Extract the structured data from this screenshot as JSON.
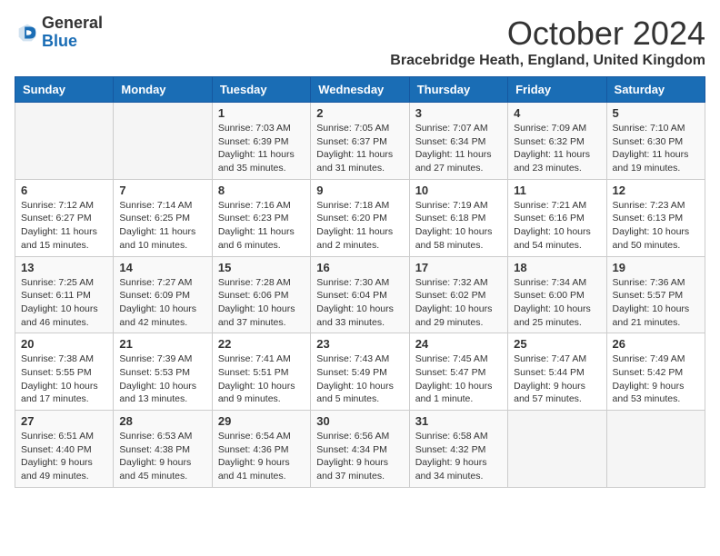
{
  "logo": {
    "general": "General",
    "blue": "Blue"
  },
  "header": {
    "month": "October 2024",
    "location": "Bracebridge Heath, England, United Kingdom"
  },
  "days_of_week": [
    "Sunday",
    "Monday",
    "Tuesday",
    "Wednesday",
    "Thursday",
    "Friday",
    "Saturday"
  ],
  "weeks": [
    [
      {
        "day": "",
        "info": ""
      },
      {
        "day": "",
        "info": ""
      },
      {
        "day": "1",
        "info": "Sunrise: 7:03 AM\nSunset: 6:39 PM\nDaylight: 11 hours and 35 minutes."
      },
      {
        "day": "2",
        "info": "Sunrise: 7:05 AM\nSunset: 6:37 PM\nDaylight: 11 hours and 31 minutes."
      },
      {
        "day": "3",
        "info": "Sunrise: 7:07 AM\nSunset: 6:34 PM\nDaylight: 11 hours and 27 minutes."
      },
      {
        "day": "4",
        "info": "Sunrise: 7:09 AM\nSunset: 6:32 PM\nDaylight: 11 hours and 23 minutes."
      },
      {
        "day": "5",
        "info": "Sunrise: 7:10 AM\nSunset: 6:30 PM\nDaylight: 11 hours and 19 minutes."
      }
    ],
    [
      {
        "day": "6",
        "info": "Sunrise: 7:12 AM\nSunset: 6:27 PM\nDaylight: 11 hours and 15 minutes."
      },
      {
        "day": "7",
        "info": "Sunrise: 7:14 AM\nSunset: 6:25 PM\nDaylight: 11 hours and 10 minutes."
      },
      {
        "day": "8",
        "info": "Sunrise: 7:16 AM\nSunset: 6:23 PM\nDaylight: 11 hours and 6 minutes."
      },
      {
        "day": "9",
        "info": "Sunrise: 7:18 AM\nSunset: 6:20 PM\nDaylight: 11 hours and 2 minutes."
      },
      {
        "day": "10",
        "info": "Sunrise: 7:19 AM\nSunset: 6:18 PM\nDaylight: 10 hours and 58 minutes."
      },
      {
        "day": "11",
        "info": "Sunrise: 7:21 AM\nSunset: 6:16 PM\nDaylight: 10 hours and 54 minutes."
      },
      {
        "day": "12",
        "info": "Sunrise: 7:23 AM\nSunset: 6:13 PM\nDaylight: 10 hours and 50 minutes."
      }
    ],
    [
      {
        "day": "13",
        "info": "Sunrise: 7:25 AM\nSunset: 6:11 PM\nDaylight: 10 hours and 46 minutes."
      },
      {
        "day": "14",
        "info": "Sunrise: 7:27 AM\nSunset: 6:09 PM\nDaylight: 10 hours and 42 minutes."
      },
      {
        "day": "15",
        "info": "Sunrise: 7:28 AM\nSunset: 6:06 PM\nDaylight: 10 hours and 37 minutes."
      },
      {
        "day": "16",
        "info": "Sunrise: 7:30 AM\nSunset: 6:04 PM\nDaylight: 10 hours and 33 minutes."
      },
      {
        "day": "17",
        "info": "Sunrise: 7:32 AM\nSunset: 6:02 PM\nDaylight: 10 hours and 29 minutes."
      },
      {
        "day": "18",
        "info": "Sunrise: 7:34 AM\nSunset: 6:00 PM\nDaylight: 10 hours and 25 minutes."
      },
      {
        "day": "19",
        "info": "Sunrise: 7:36 AM\nSunset: 5:57 PM\nDaylight: 10 hours and 21 minutes."
      }
    ],
    [
      {
        "day": "20",
        "info": "Sunrise: 7:38 AM\nSunset: 5:55 PM\nDaylight: 10 hours and 17 minutes."
      },
      {
        "day": "21",
        "info": "Sunrise: 7:39 AM\nSunset: 5:53 PM\nDaylight: 10 hours and 13 minutes."
      },
      {
        "day": "22",
        "info": "Sunrise: 7:41 AM\nSunset: 5:51 PM\nDaylight: 10 hours and 9 minutes."
      },
      {
        "day": "23",
        "info": "Sunrise: 7:43 AM\nSunset: 5:49 PM\nDaylight: 10 hours and 5 minutes."
      },
      {
        "day": "24",
        "info": "Sunrise: 7:45 AM\nSunset: 5:47 PM\nDaylight: 10 hours and 1 minute."
      },
      {
        "day": "25",
        "info": "Sunrise: 7:47 AM\nSunset: 5:44 PM\nDaylight: 9 hours and 57 minutes."
      },
      {
        "day": "26",
        "info": "Sunrise: 7:49 AM\nSunset: 5:42 PM\nDaylight: 9 hours and 53 minutes."
      }
    ],
    [
      {
        "day": "27",
        "info": "Sunrise: 6:51 AM\nSunset: 4:40 PM\nDaylight: 9 hours and 49 minutes."
      },
      {
        "day": "28",
        "info": "Sunrise: 6:53 AM\nSunset: 4:38 PM\nDaylight: 9 hours and 45 minutes."
      },
      {
        "day": "29",
        "info": "Sunrise: 6:54 AM\nSunset: 4:36 PM\nDaylight: 9 hours and 41 minutes."
      },
      {
        "day": "30",
        "info": "Sunrise: 6:56 AM\nSunset: 4:34 PM\nDaylight: 9 hours and 37 minutes."
      },
      {
        "day": "31",
        "info": "Sunrise: 6:58 AM\nSunset: 4:32 PM\nDaylight: 9 hours and 34 minutes."
      },
      {
        "day": "",
        "info": ""
      },
      {
        "day": "",
        "info": ""
      }
    ]
  ]
}
